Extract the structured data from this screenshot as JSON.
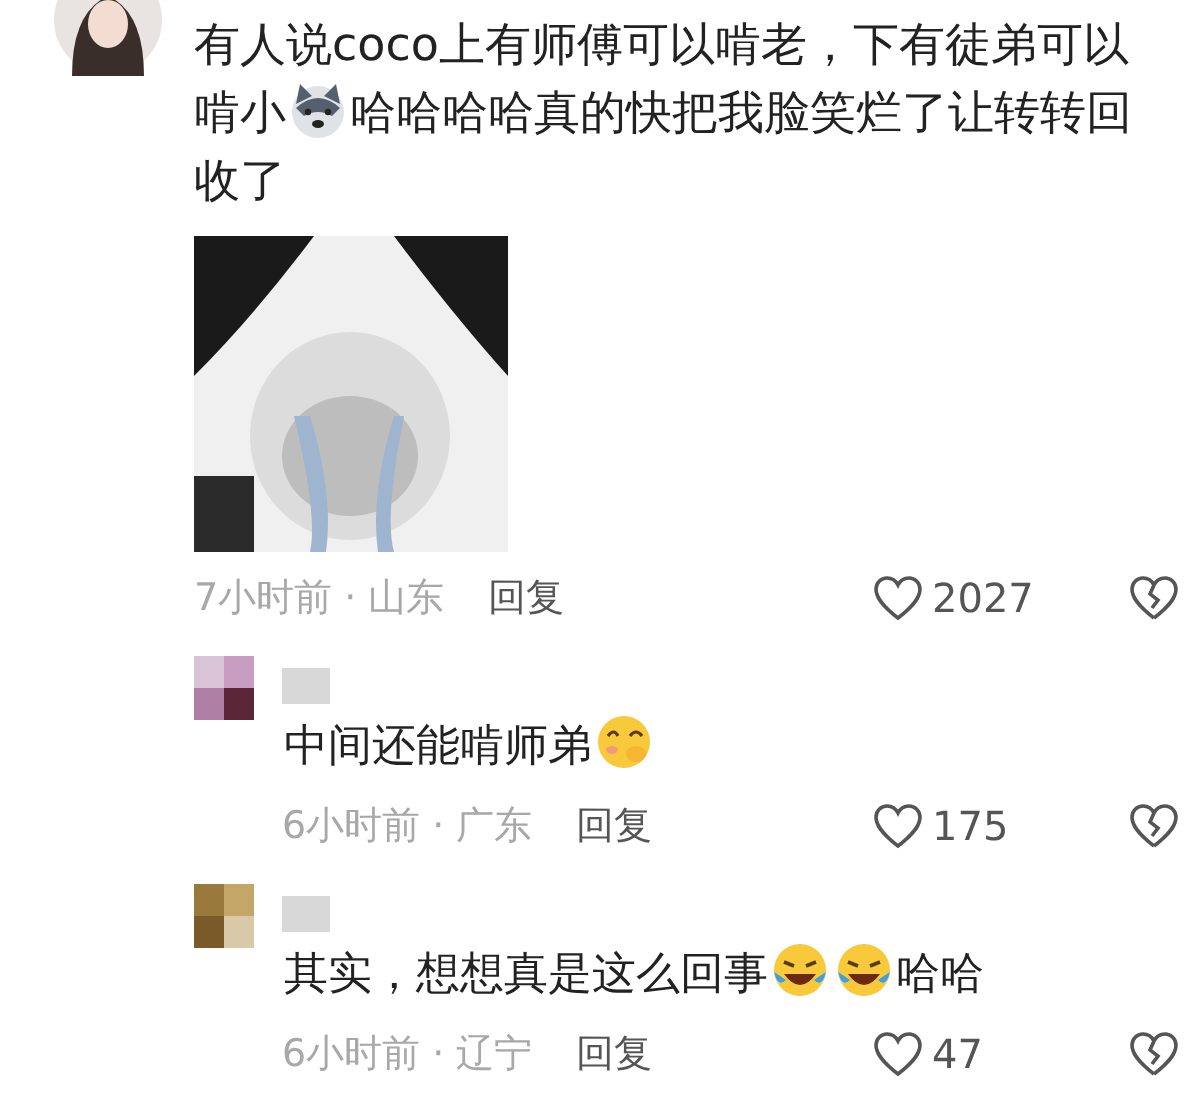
{
  "comment": {
    "lines": [
      [
        {
          "kind": "text",
          "text": "有人说coco上有师傅可以啃老，下有徒弟可以"
        }
      ],
      [
        {
          "kind": "text",
          "text": "啃小"
        },
        {
          "kind": "dog_emoji"
        },
        {
          "kind": "text",
          "text": "哈哈哈哈真的快把我脸笑烂了让转转回"
        }
      ],
      [
        {
          "kind": "text",
          "text": "收了"
        }
      ]
    ],
    "attachment": {
      "kind": "picture"
    },
    "time_location": "7小时前 · 山东",
    "reply_label": "回复",
    "likes": "2027"
  },
  "replies": [
    {
      "segments": [
        {
          "kind": "text",
          "text": "中间还能啃师弟"
        },
        {
          "kind": "smirk_emoji"
        }
      ],
      "time_location": "6小时前 · 广东",
      "reply_label": "回复",
      "likes": "175"
    },
    {
      "segments": [
        {
          "kind": "text",
          "text": "其实，想想真是这么回事"
        },
        {
          "kind": "laugh_cry_emoji"
        },
        {
          "kind": "laugh_cry_emoji"
        },
        {
          "kind": "text",
          "text": "哈哈"
        }
      ],
      "time_location": "6小时前 · 辽宁",
      "reply_label": "回复",
      "likes": "47"
    }
  ]
}
